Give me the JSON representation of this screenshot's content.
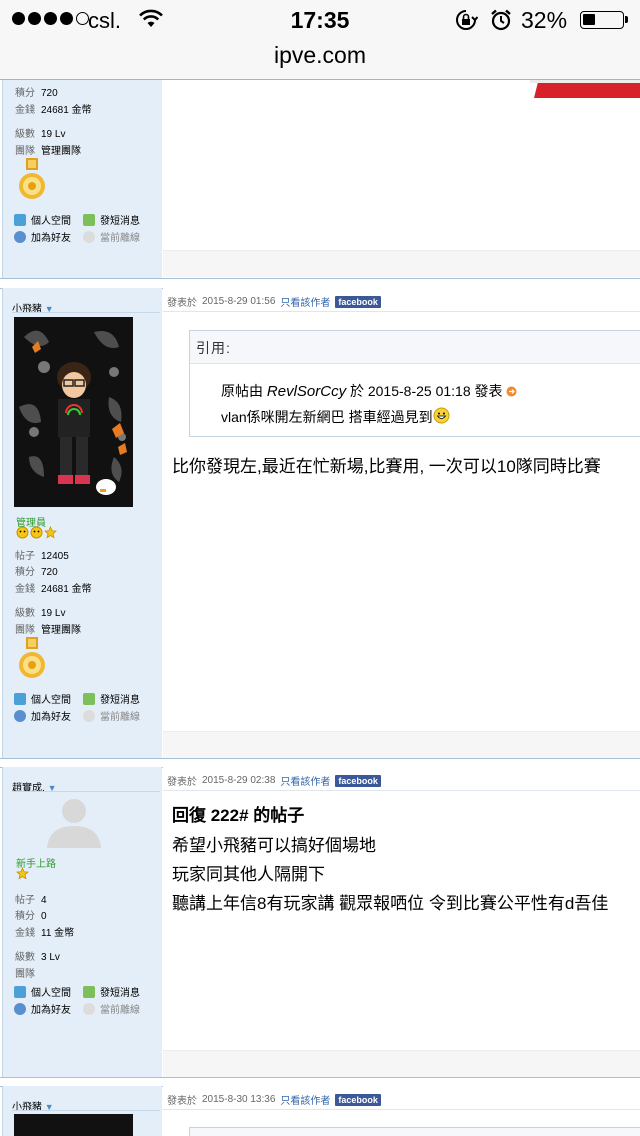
{
  "status_bar": {
    "carrier": "csl.",
    "time": "17:35",
    "battery_pct": "32%",
    "battery_level": 0.32,
    "signal_dots_filled": 4,
    "signal_dots_total": 5
  },
  "url": "ipve.com",
  "labels": {
    "posts": "帖子",
    "points": "積分",
    "money": "金錢",
    "level": "級數",
    "team": "團隊",
    "personal_space": "個人空間",
    "send_message": "發短消息",
    "add_friend": "加為好友",
    "offline": "當前離線",
    "facebook": "facebook",
    "posted_at_prefix": "發表於",
    "only_author": "只看該作者"
  },
  "post0": {
    "points": "720",
    "money": "24681 金幣",
    "level": "19 Lv",
    "team": "管理團隊"
  },
  "post1": {
    "username": "小飛豬",
    "rank": "管理員",
    "posts": "12405",
    "points": "720",
    "money": "24681 金幣",
    "level": "19 Lv",
    "team": "管理團隊",
    "date": "2015-8-29 01:56",
    "quote_label": "引用:",
    "quote_by": "原帖由",
    "quote_author": "RevlSorCcy",
    "quote_on": "於 2015-8-25 01:18 發表",
    "quote_text": "vlan係咪開左新網巴  搭車經過見到",
    "body": "比你發現左,最近在忙新場,比賽用, 一次可以10隊同時比賽"
  },
  "post2": {
    "username": "趙實成.",
    "rank": "新手上路",
    "posts": "4",
    "points": "0",
    "money": "11 金幣",
    "level": "3 Lv",
    "team": "",
    "date": "2015-8-29 02:38",
    "reply_title": "回復 222# 的帖子",
    "lines": [
      "希望小飛豬可以搞好個場地",
      "玩家同其他人隔開下",
      "聽講上年信8有玩家講  觀眾報哂位 令到比賽公平性有d吾佳"
    ]
  },
  "post3": {
    "username": "小飛豬",
    "date": "2015-8-30 13:36"
  }
}
